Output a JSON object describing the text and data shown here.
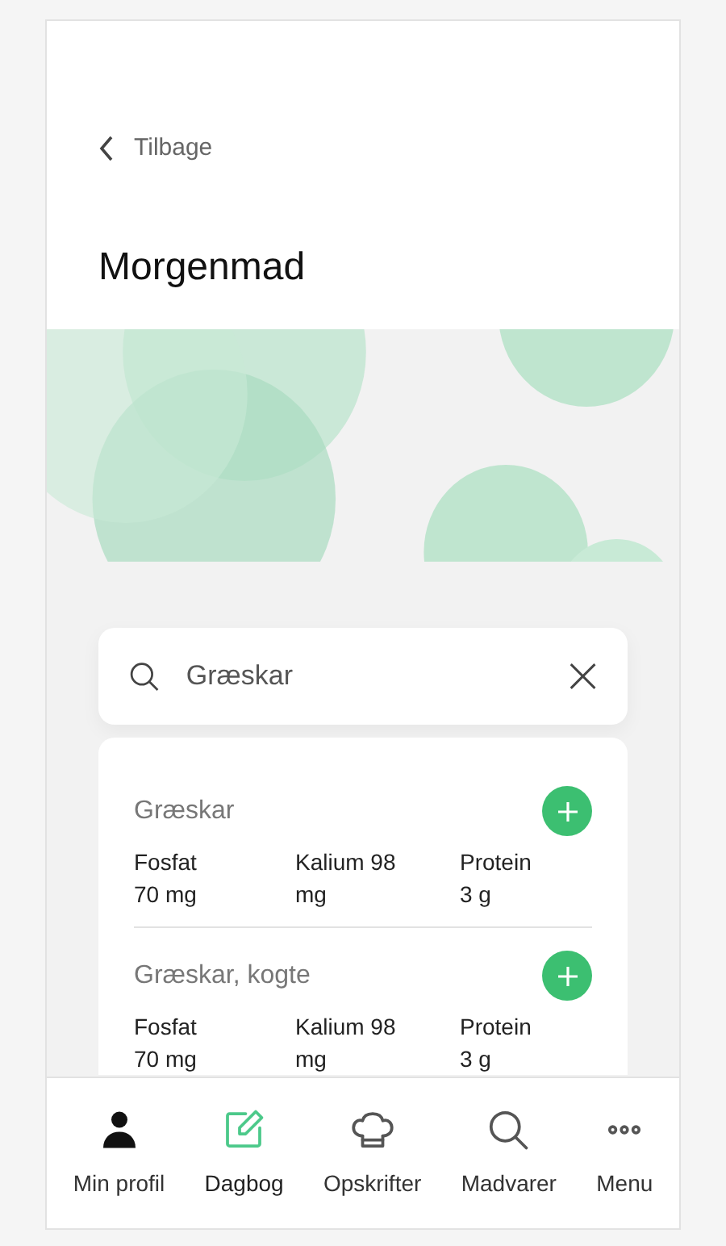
{
  "header": {
    "back_label": "Tilbage",
    "title": "Morgenmad"
  },
  "search": {
    "value": "Græskar"
  },
  "results": [
    {
      "name": "Græskar",
      "nutrients": [
        "Fosfat 70 mg",
        "Kalium 98 mg",
        "Protein 3 g"
      ]
    },
    {
      "name": "Græskar, kogte",
      "nutrients": [
        "Fosfat 70 mg",
        "Kalium 98 mg",
        "Protein 3 g"
      ]
    }
  ],
  "nav": [
    {
      "kind": "profile",
      "label": "Min profil",
      "selected": false
    },
    {
      "kind": "diary",
      "label": "Dagbog",
      "selected": true
    },
    {
      "kind": "recipes",
      "label": "Opskrifter",
      "selected": false
    },
    {
      "kind": "foods",
      "label": "Madvarer",
      "selected": false
    },
    {
      "kind": "menu",
      "label": "Menu",
      "selected": false
    }
  ]
}
